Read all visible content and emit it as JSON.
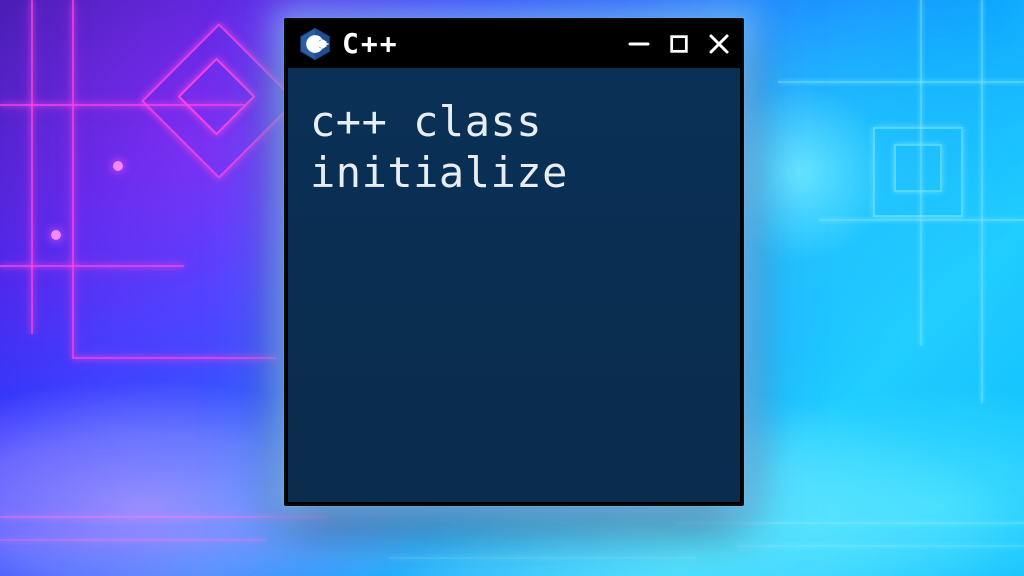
{
  "window": {
    "title": "C++",
    "icon_name": "cpp-logo-icon",
    "controls": {
      "minimize": "minimize-icon",
      "maximize": "maximize-icon",
      "close": "close-icon"
    }
  },
  "terminal": {
    "content": "c++ class\ninitialize"
  },
  "colors": {
    "titlebar_bg": "#000000",
    "terminal_bg": "#0a2f52",
    "terminal_fg": "#e8edf2",
    "glow": "#8cc8ff"
  }
}
